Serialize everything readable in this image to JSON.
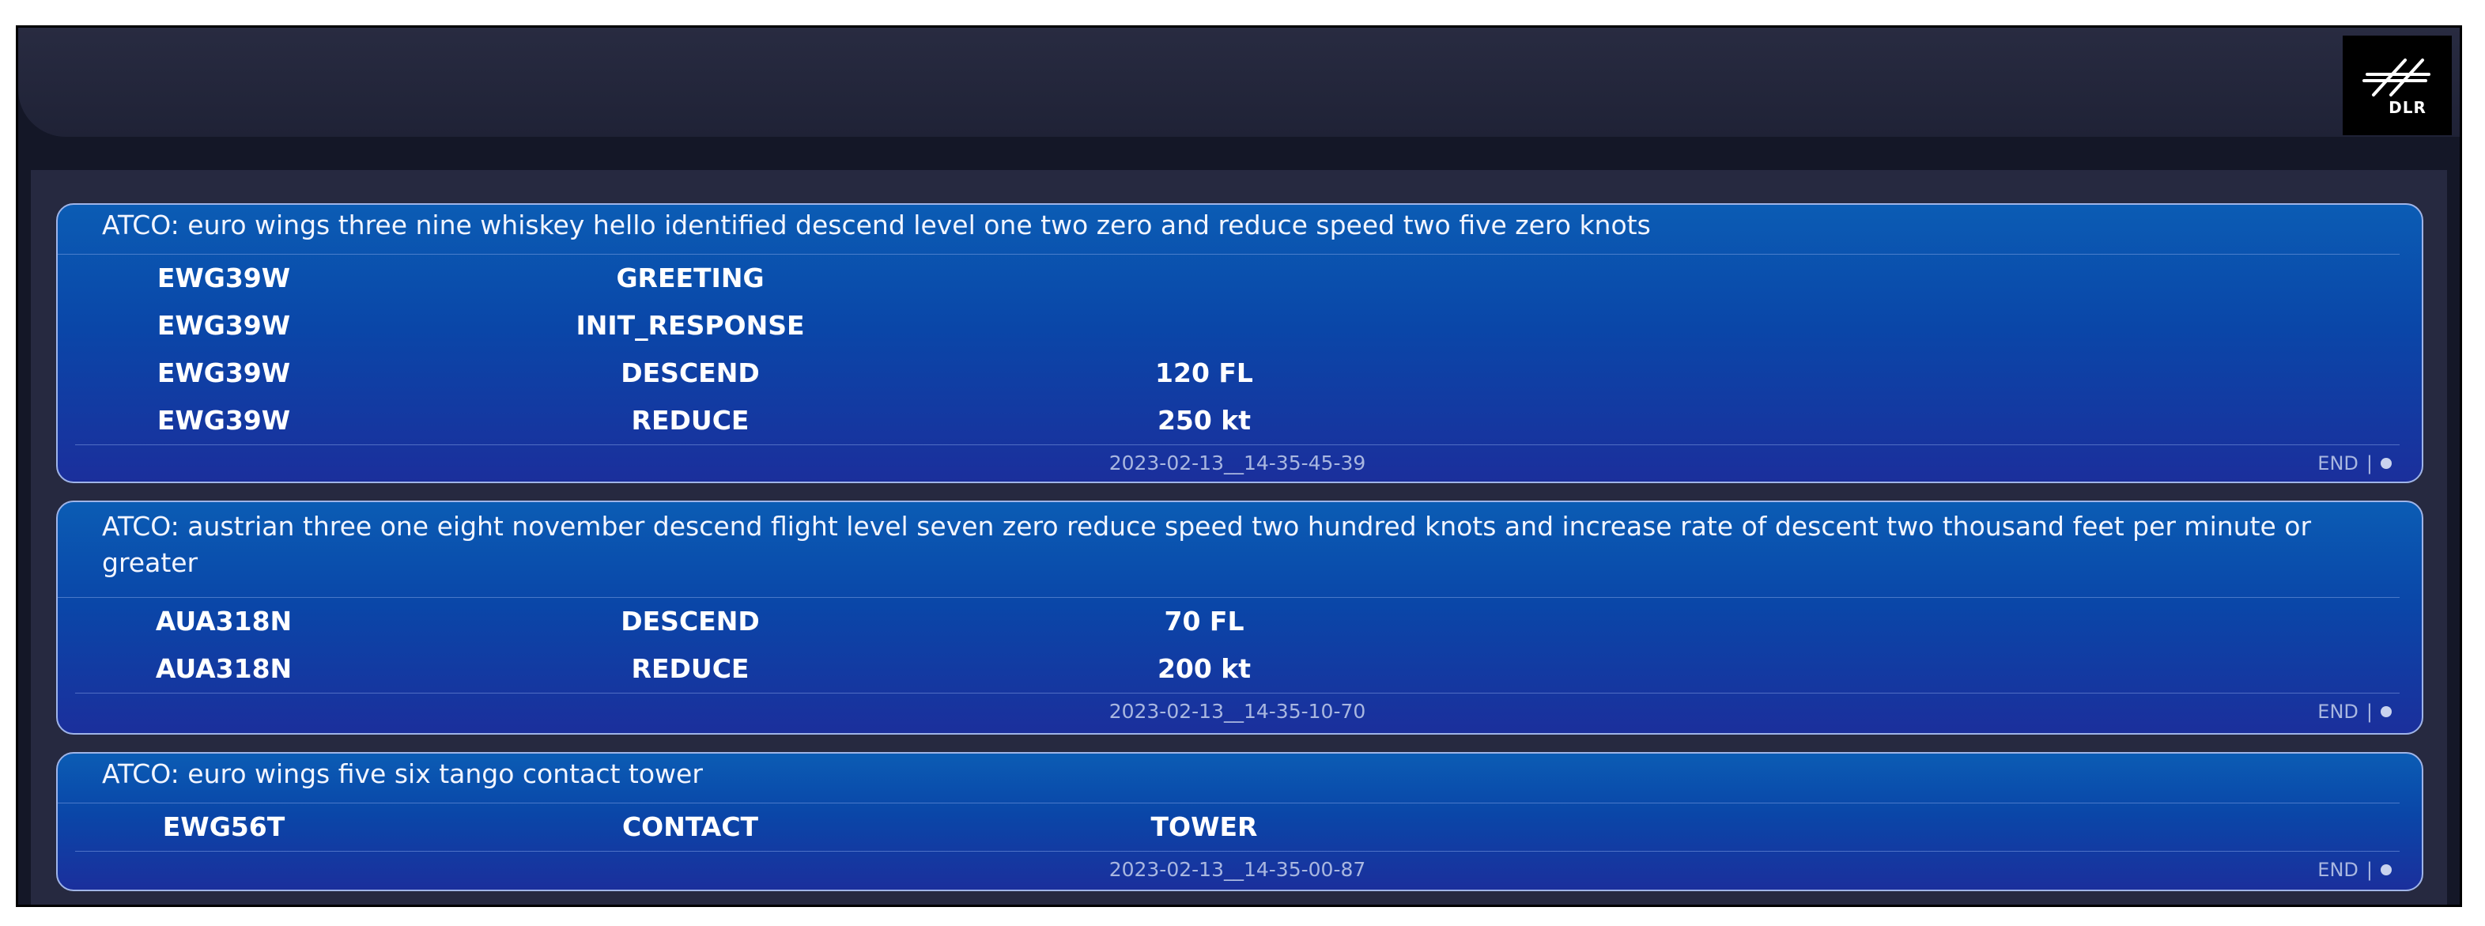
{
  "logo": {
    "text": "DLR"
  },
  "messages": [
    {
      "text": "ATCO: euro wings three nine whiskey hello identified descend level one two zero and reduce speed two five zero knots",
      "rows": [
        {
          "callsign": "EWG39W",
          "command": "GREETING",
          "value": ""
        },
        {
          "callsign": "EWG39W",
          "command": "INIT_RESPONSE",
          "value": ""
        },
        {
          "callsign": "EWG39W",
          "command": "DESCEND",
          "value": "120 FL"
        },
        {
          "callsign": "EWG39W",
          "command": "REDUCE",
          "value": "250 kt"
        }
      ],
      "timestamp": "2023-02-13__14-35-45-39",
      "end_label": "END",
      "separator": "|"
    },
    {
      "text": "ATCO: austrian three one eight november descend flight level seven zero reduce speed two hundred knots and increase rate of descent two thousand feet per minute or greater",
      "rows": [
        {
          "callsign": "AUA318N",
          "command": "DESCEND",
          "value": "70 FL"
        },
        {
          "callsign": "AUA318N",
          "command": "REDUCE",
          "value": "200 kt"
        }
      ],
      "timestamp": "2023-02-13__14-35-10-70",
      "end_label": "END",
      "separator": "|"
    },
    {
      "text": "ATCO: euro wings five six tango contact tower",
      "rows": [
        {
          "callsign": "EWG56T",
          "command": "CONTACT",
          "value": "TOWER"
        }
      ],
      "timestamp": "2023-02-13__14-35-00-87",
      "end_label": "END",
      "separator": "|"
    }
  ]
}
